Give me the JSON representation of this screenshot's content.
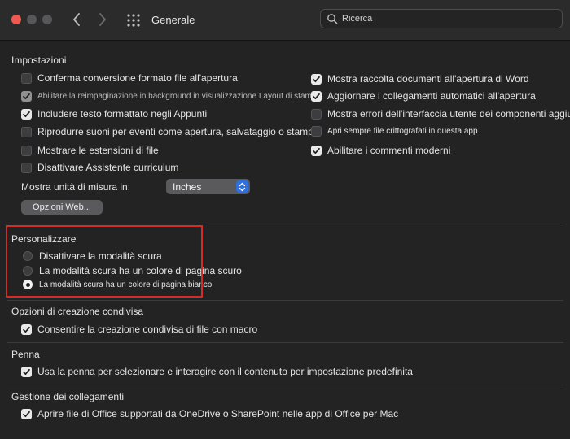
{
  "window": {
    "title": "Generale",
    "search": {
      "placeholder": "Ricerca"
    }
  },
  "impostazioni": {
    "heading": "Impostazioni",
    "left": [
      {
        "label": "Conferma conversione formato file all'apertura",
        "checked": false
      },
      {
        "label": "Abilitare la reimpaginazione in background in visualizzazione Layout di stampa",
        "checked": true
      },
      {
        "label": "Includere testo formattato negli Appunti",
        "checked": true
      },
      {
        "label": "Riprodurre suoni per eventi come apertura, salvataggio o stampa",
        "checked": false
      },
      {
        "label": "Mostrare le estensioni di file",
        "checked": false
      },
      {
        "label": "Disattivare Assistente curriculum",
        "checked": false
      }
    ],
    "right": [
      {
        "label": "Mostra raccolta documenti all'apertura di Word",
        "checked": true
      },
      {
        "label": "Aggiornare i collegamenti automatici all'apertura",
        "checked": true
      },
      {
        "label": "Mostra errori dell'interfaccia utente dei componenti aggiuntivi",
        "checked": false
      },
      {
        "label": "Apri sempre file crittografati in questa app",
        "checked": false
      },
      {
        "label": "Abilitare i commenti moderni",
        "checked": true
      }
    ],
    "units_label": "Mostra unità di misura in:",
    "units_value": "Inches",
    "web_options_button": "Opzioni Web..."
  },
  "personalizzare": {
    "heading": "Personalizzare",
    "options": [
      {
        "label": "Disattivare la modalità scura",
        "selected": false
      },
      {
        "label": "La modalità scura ha un colore di pagina scuro",
        "selected": false
      },
      {
        "label": "La modalità scura ha un colore di pagina bianco",
        "selected": true
      }
    ]
  },
  "creazione_condivisa": {
    "heading": "Opzioni di creazione condivisa",
    "items": [
      {
        "label": "Consentire la creazione condivisa di file con macro",
        "checked": true
      }
    ]
  },
  "penna": {
    "heading": "Penna",
    "items": [
      {
        "label": "Usa la penna per selezionare e interagire con il contenuto per impostazione predefinita",
        "checked": true
      }
    ]
  },
  "collegamenti": {
    "heading": "Gestione dei collegamenti",
    "items": [
      {
        "label": "Aprire file di Office supportati da OneDrive o SharePoint nelle app di Office per Mac",
        "checked": true
      }
    ]
  },
  "colors": {
    "highlight": "#d92a2a",
    "accent": "#2f6fe0",
    "close_button": "#ee5a52",
    "background": "#232324"
  }
}
